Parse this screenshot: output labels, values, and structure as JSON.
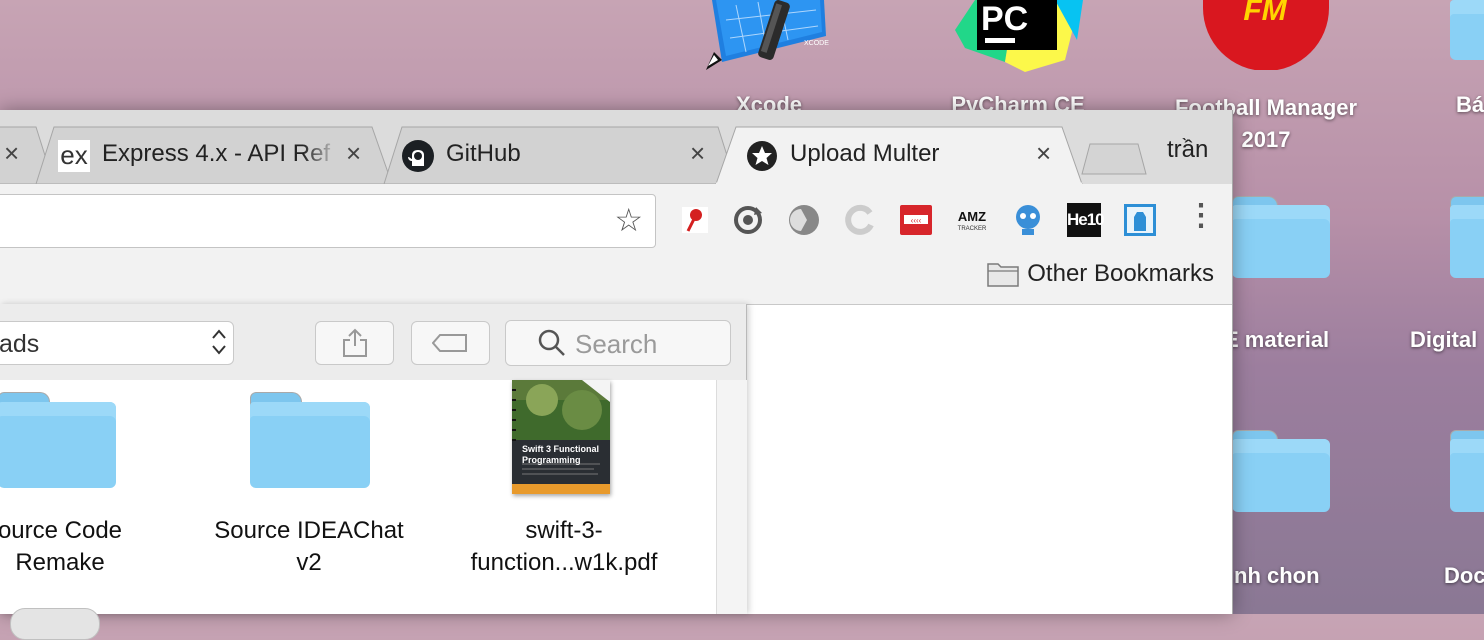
{
  "desktop": {
    "icons": [
      {
        "label": "Xcode"
      },
      {
        "label": "PyCharm CE"
      },
      {
        "label": "Football Manager 2017",
        "line1": "Football Manager",
        "line2": "2017"
      },
      {
        "label": "Bá"
      }
    ],
    "folders": [
      {
        "label": "E material"
      },
      {
        "label": "Digital"
      },
      {
        "label": "nh chon"
      },
      {
        "label": "Doc"
      }
    ]
  },
  "browser": {
    "tabs": [
      {
        "title": "",
        "close": "×"
      },
      {
        "title": "Express 4.x - API Ref",
        "favicon": "ex",
        "close": "×"
      },
      {
        "title": "GitHub",
        "favicon": "github-icon",
        "close": "×"
      },
      {
        "title": "Upload Multer",
        "favicon": "star-icon",
        "close": "×",
        "active": true
      }
    ],
    "profile_name": "trần",
    "bookmarks": {
      "other": "Other Bookmarks"
    },
    "extension_labels": {
      "amz": "AMZ",
      "amz_sub": "TRACKER",
      "he10": "He10"
    },
    "menu_glyph": "⋮",
    "star_glyph": "☆"
  },
  "finder": {
    "location": "ads",
    "search_placeholder": "Search",
    "items": [
      {
        "line1": "ource Code",
        "line2": "Remake"
      },
      {
        "line1": "Source IDEAChat",
        "line2": "v2"
      },
      {
        "line1": "swift-3-",
        "line2": "function...w1k.pdf"
      }
    ],
    "book_cover": {
      "line1": "Swift 3 Functional",
      "line2": "Programming"
    }
  }
}
